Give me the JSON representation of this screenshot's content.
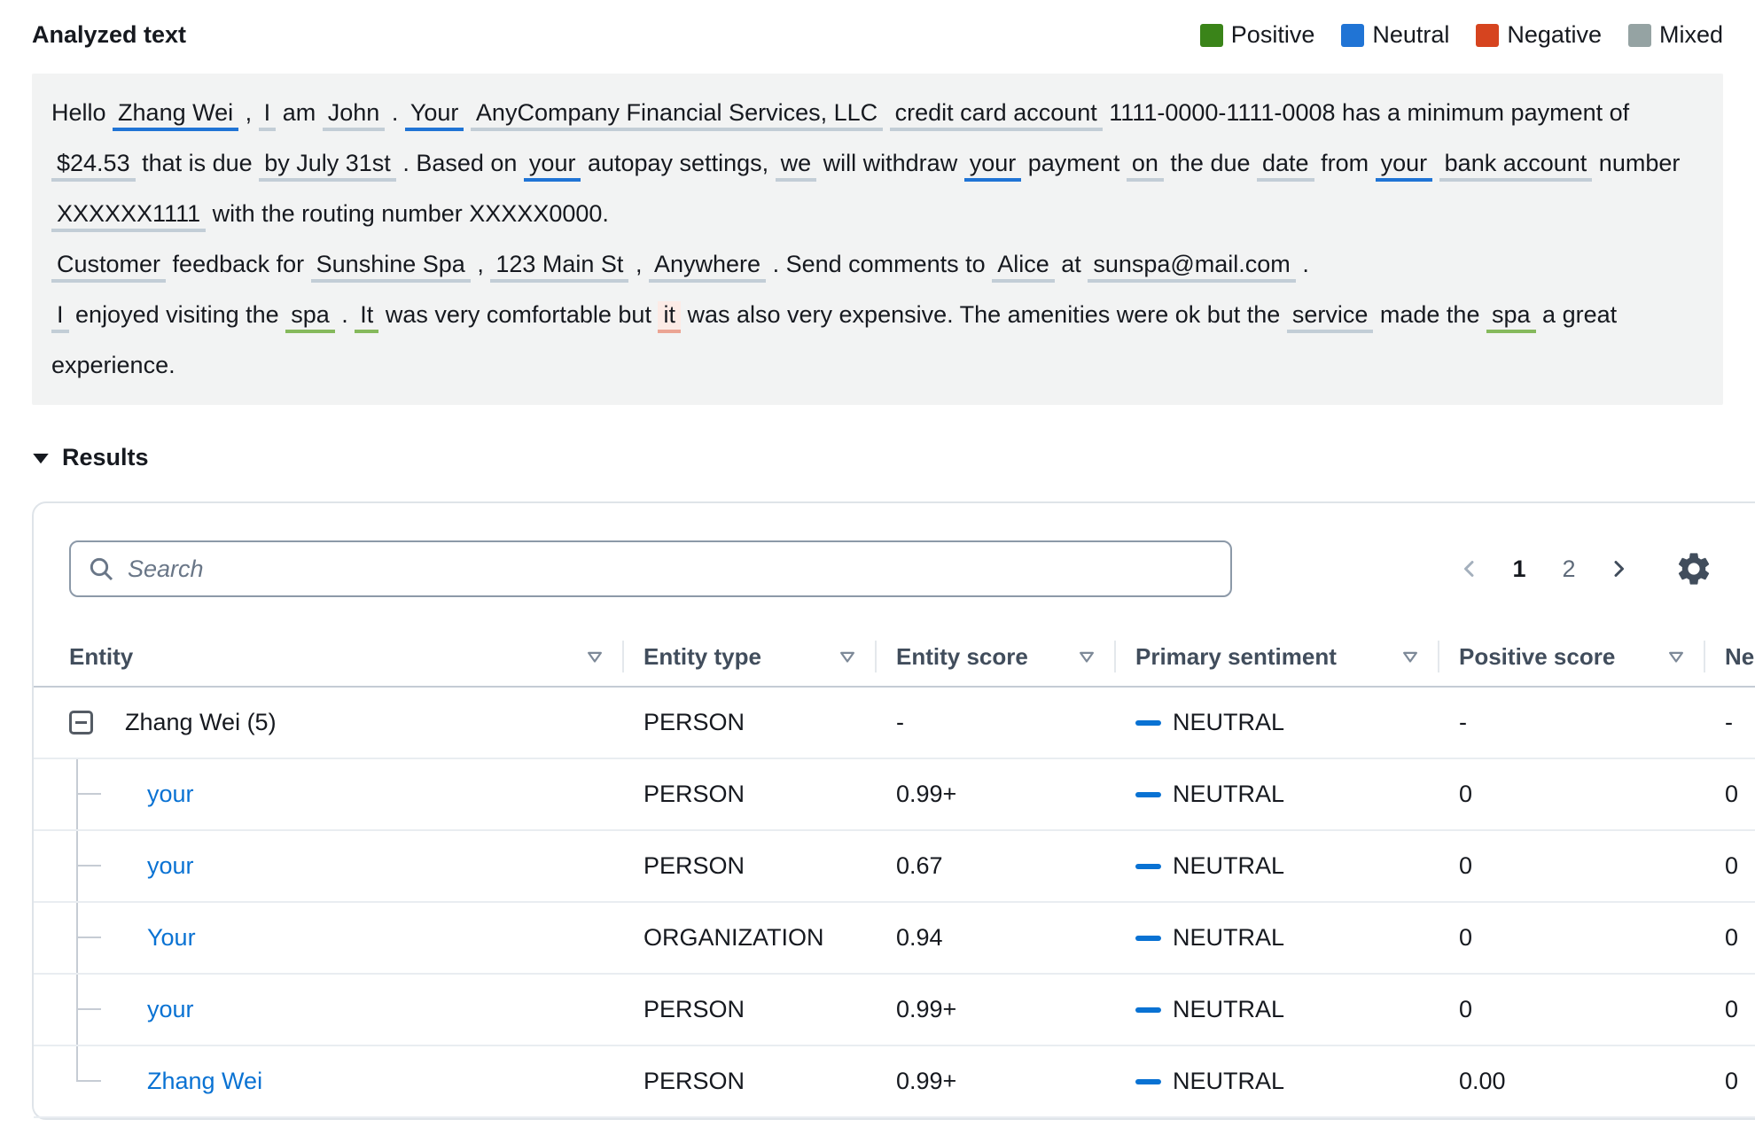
{
  "analyzed": {
    "title": "Analyzed text",
    "legend": [
      {
        "label": "Positive",
        "color": "#3a8419"
      },
      {
        "label": "Neutral",
        "color": "#2074d5"
      },
      {
        "label": "Negative",
        "color": "#d6441f"
      },
      {
        "label": "Mixed",
        "color": "#95a3a3"
      }
    ],
    "entity_underline_colors": {
      "neutral_strong": "#2074d5",
      "neutral": "#c2cdd6",
      "positive": "#85b95c",
      "negative": "#eba493"
    },
    "paragraphs": [
      [
        {
          "t": "Hello"
        },
        {
          "t": "Zhang Wei",
          "e": "neutral-strong"
        },
        {
          "t": ","
        },
        {
          "t": "I",
          "e": "neutral"
        },
        {
          "t": "am"
        },
        {
          "t": "John",
          "e": "neutral"
        },
        {
          "t": "."
        },
        {
          "t": "Your",
          "e": "neutral-strong"
        },
        {
          "t": "AnyCompany Financial Services, LLC",
          "e": "neutral"
        },
        {
          "t": "credit card account",
          "e": "neutral"
        },
        {
          "t": "1111-0000-1111-0008 has a minimum payment of"
        },
        {
          "t": "$24.53",
          "e": "neutral"
        },
        {
          "t": "that is due"
        },
        {
          "t": "by July 31st",
          "e": "neutral"
        },
        {
          "t": ". Based on"
        },
        {
          "t": "your",
          "e": "neutral-strong"
        },
        {
          "t": "autopay settings,"
        },
        {
          "t": "we",
          "e": "neutral"
        },
        {
          "t": "will withdraw"
        },
        {
          "t": "your",
          "e": "neutral-strong"
        },
        {
          "t": "payment"
        },
        {
          "t": "on",
          "e": "neutral"
        },
        {
          "t": "the due"
        },
        {
          "t": "date",
          "e": "neutral"
        },
        {
          "t": "from"
        },
        {
          "t": "your",
          "e": "neutral-strong"
        },
        {
          "t": "bank account",
          "e": "neutral"
        },
        {
          "t": "number"
        },
        {
          "t": "XXXXXX1111",
          "e": "neutral"
        },
        {
          "t": "with the routing number XXXXX0000."
        }
      ],
      [
        {
          "t": "Customer",
          "e": "neutral"
        },
        {
          "t": "feedback for"
        },
        {
          "t": "Sunshine Spa",
          "e": "neutral"
        },
        {
          "t": ","
        },
        {
          "t": "123 Main St",
          "e": "neutral"
        },
        {
          "t": ","
        },
        {
          "t": "Anywhere",
          "e": "neutral"
        },
        {
          "t": ". Send comments to"
        },
        {
          "t": "Alice",
          "e": "neutral"
        },
        {
          "t": "at"
        },
        {
          "t": "sunspa@mail.com",
          "e": "neutral"
        },
        {
          "t": "."
        }
      ],
      [
        {
          "t": "I",
          "e": "neutral"
        },
        {
          "t": "enjoyed visiting the"
        },
        {
          "t": "spa",
          "e": "positive"
        },
        {
          "t": "."
        },
        {
          "t": "It",
          "e": "positive"
        },
        {
          "t": "was very comfortable but"
        },
        {
          "t": "it",
          "e": "negative"
        },
        {
          "t": "was also very expensive. The amenities were ok but the"
        },
        {
          "t": "service",
          "e": "neutral"
        },
        {
          "t": "made the"
        },
        {
          "t": "spa",
          "e": "positive"
        },
        {
          "t": "a great experience."
        }
      ]
    ]
  },
  "results": {
    "title": "Results",
    "search_placeholder": "Search",
    "pagination": {
      "pages": [
        "1",
        "2"
      ],
      "current": "1"
    },
    "columns": [
      {
        "label": "Entity"
      },
      {
        "label": "Entity type"
      },
      {
        "label": "Entity score"
      },
      {
        "label": "Primary sentiment"
      },
      {
        "label": "Positive score"
      },
      {
        "label": "Negative score"
      }
    ],
    "sentiment_dash_color": "#0972d3",
    "link_color": "#0972d3",
    "rows": [
      {
        "entity": "Zhang Wei (5)",
        "entity_type": "PERSON",
        "entity_score": "-",
        "primary_sentiment": "NEUTRAL",
        "positive_score": "-",
        "negative_score": "-"
      },
      {
        "entity": "your",
        "entity_type": "PERSON",
        "entity_score": "0.99+",
        "primary_sentiment": "NEUTRAL",
        "positive_score": "0",
        "negative_score": "0"
      },
      {
        "entity": "your",
        "entity_type": "PERSON",
        "entity_score": "0.67",
        "primary_sentiment": "NEUTRAL",
        "positive_score": "0",
        "negative_score": "0"
      },
      {
        "entity": "Your",
        "entity_type": "ORGANIZATION",
        "entity_score": "0.94",
        "primary_sentiment": "NEUTRAL",
        "positive_score": "0",
        "negative_score": "0"
      },
      {
        "entity": "your",
        "entity_type": "PERSON",
        "entity_score": "0.99+",
        "primary_sentiment": "NEUTRAL",
        "positive_score": "0",
        "negative_score": "0"
      },
      {
        "entity": "Zhang Wei",
        "entity_type": "PERSON",
        "entity_score": "0.99+",
        "primary_sentiment": "NEUTRAL",
        "positive_score": "0.00",
        "negative_score": "0"
      }
    ]
  }
}
